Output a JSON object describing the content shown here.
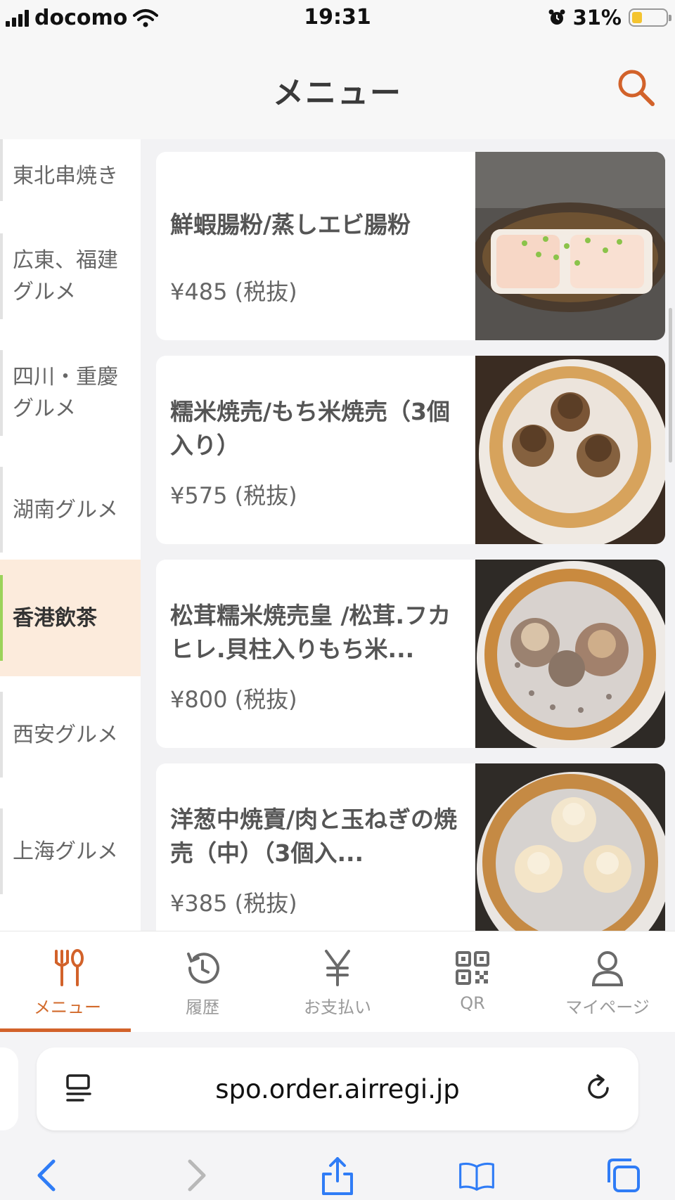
{
  "status_bar": {
    "carrier": "docomo",
    "time": "19:31",
    "battery": "31%",
    "battery_level": 0.31
  },
  "header": {
    "title": "メニュー",
    "search_icon": "search-icon"
  },
  "categories": [
    {
      "label": "東北串焼き",
      "active": false
    },
    {
      "label": "広東、福建グルメ",
      "active": false
    },
    {
      "label": "四川・重慶グルメ",
      "active": false
    },
    {
      "label": "湖南グルメ",
      "active": false
    },
    {
      "label": "香港飲茶",
      "active": true
    },
    {
      "label": "西安グルメ",
      "active": false
    },
    {
      "label": "上海グルメ",
      "active": false
    }
  ],
  "menu_items": [
    {
      "name": "鮮蝦腸粉/蒸しエビ腸粉",
      "price": "¥485 (税抜)"
    },
    {
      "name": "糯米焼売/もち米焼売（3個入り）",
      "price": "¥575 (税抜)"
    },
    {
      "name": "松茸糯米焼売皇 /松茸.フカヒレ.貝柱入りもち米...",
      "price": "¥800 (税抜)"
    },
    {
      "name": "洋葱中焼賣/肉と玉ねぎの焼売（中）（3個入...",
      "price": "¥385 (税抜)"
    }
  ],
  "tabs": [
    {
      "label": "メニュー",
      "icon": "fork-spoon-icon",
      "active": true
    },
    {
      "label": "履歴",
      "icon": "history-icon",
      "active": false
    },
    {
      "label": "お支払い",
      "icon": "yen-icon",
      "active": false
    },
    {
      "label": "QR",
      "icon": "qr-code-icon",
      "active": false
    },
    {
      "label": "マイページ",
      "icon": "person-icon",
      "active": false
    }
  ],
  "browser": {
    "url": "spo.order.airregi.jp"
  },
  "colors": {
    "accent": "#d2622a",
    "active_category_bg": "#fcebdc",
    "active_category_bar": "#9bd35a",
    "ios_blue": "#2f7cf6"
  }
}
